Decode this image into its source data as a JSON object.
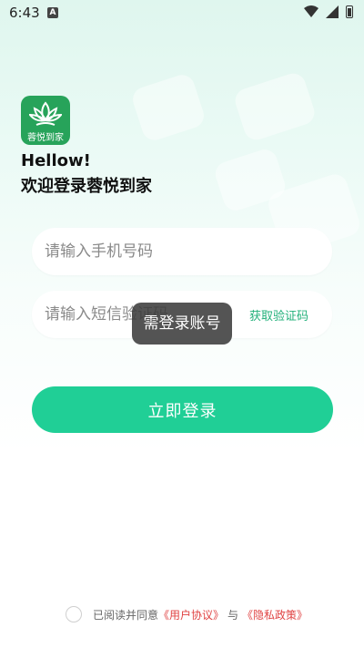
{
  "status_bar": {
    "time": "6:43",
    "notification": "A"
  },
  "logo": {
    "text": "蓉悦到家"
  },
  "header": {
    "greeting": "Hellow!",
    "welcome": "欢迎登录蓉悦到家"
  },
  "phone_input": {
    "placeholder": "请输入手机号码",
    "value": ""
  },
  "code_input": {
    "placeholder": "请输入短信验证码",
    "value": ""
  },
  "get_code_label": "获取验证码",
  "toast": "需登录账号",
  "login_button": "立即登录",
  "agreement": {
    "prefix": "已阅读并同意",
    "user_agreement": "《用户协议》",
    "conjunction": "与",
    "privacy_policy": "《隐私政策》"
  },
  "colors": {
    "accent": "#20cf96",
    "logo_bg": "#27a35a",
    "link": "#e04343"
  }
}
